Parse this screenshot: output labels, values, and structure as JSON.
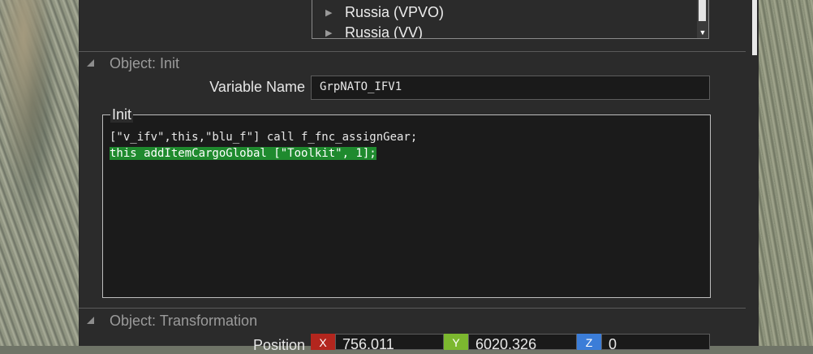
{
  "faction_list": {
    "items": [
      {
        "label": "Russia (VPVO)"
      },
      {
        "label": "Russia (VV)"
      }
    ]
  },
  "sections": {
    "init": {
      "title": "Object: Init"
    },
    "transformation": {
      "title": "Object: Transformation"
    }
  },
  "variable_name": {
    "label": "Variable Name",
    "value": "GrpNATO_IFV1"
  },
  "init_field": {
    "label": "Init",
    "lines": [
      "[\"v_ifv\",this,\"blu_f\"] call f_fnc_assignGear;",
      "this addItemCargoGlobal [\"Toolkit\", 1];"
    ]
  },
  "position": {
    "label": "Position",
    "x": {
      "badge": "X",
      "value": "756.011",
      "color": "#b3261e"
    },
    "y": {
      "badge": "Y",
      "value": "6020.326",
      "color": "#7cb82f"
    },
    "z": {
      "badge": "Z",
      "value": "0",
      "color": "#3b7dd8"
    }
  }
}
